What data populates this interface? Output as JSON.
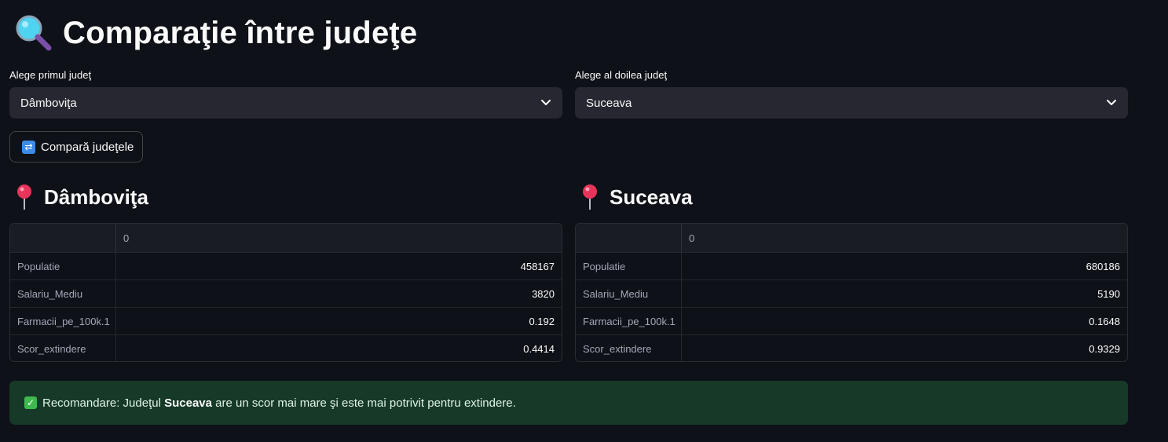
{
  "page": {
    "title": "Comparaţie între judeţe",
    "title_icon": "magnifier-icon"
  },
  "selectors": {
    "first": {
      "label": "Alege primul judeţ",
      "value": "Dâmboviţa"
    },
    "second": {
      "label": "Alege al doilea judeţ",
      "value": "Suceava"
    }
  },
  "compare_button": {
    "label": "Compară judeţele",
    "icon": "refresh-icon"
  },
  "counties": [
    {
      "name": "Dâmboviţa",
      "icon": "pin-icon",
      "table": {
        "column": "0",
        "rows": [
          {
            "index": "Populatie",
            "value": "458167"
          },
          {
            "index": "Salariu_Mediu",
            "value": "3820"
          },
          {
            "index": "Farmacii_pe_100k.1",
            "value": "0.192"
          },
          {
            "index": "Scor_extindere",
            "value": "0.4414"
          }
        ]
      }
    },
    {
      "name": "Suceava",
      "icon": "pin-icon",
      "table": {
        "column": "0",
        "rows": [
          {
            "index": "Populatie",
            "value": "680186"
          },
          {
            "index": "Salariu_Mediu",
            "value": "5190"
          },
          {
            "index": "Farmacii_pe_100k.1",
            "value": "0.1648"
          },
          {
            "index": "Scor_extindere",
            "value": "0.9329"
          }
        ]
      }
    }
  ],
  "recommendation": {
    "icon": "check-icon",
    "prefix": "Recomandare: Judeţul ",
    "county": "Suceava",
    "suffix": " are un scor mai mare şi este mai potrivit pentru extindere."
  },
  "colors": {
    "background": "#0e1117",
    "select_bg": "#262730",
    "success_bg": "#173928",
    "success_icon": "#3fb950",
    "button_icon": "#3d8be8",
    "pin": "#e8345b"
  }
}
